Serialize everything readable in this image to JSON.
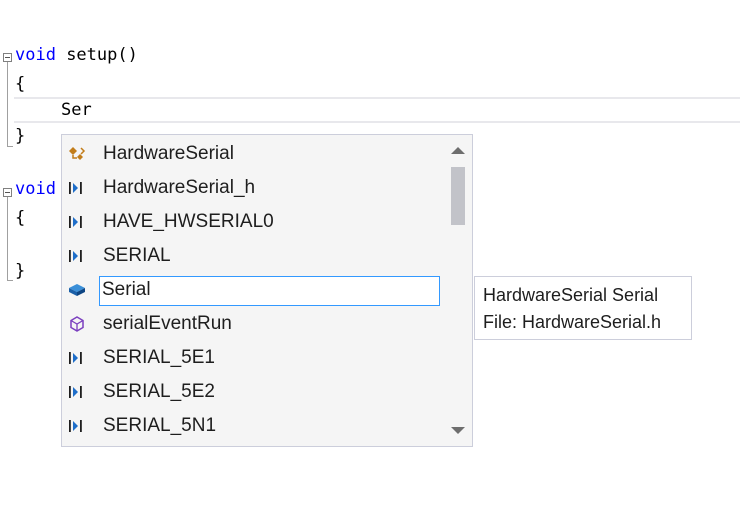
{
  "editor": {
    "line1_kw": "void",
    "line1_rest": " setup()",
    "line2": "{",
    "line3": "Ser",
    "line4": "}",
    "line5_kw": "void",
    "line6": "{",
    "line8": "}"
  },
  "completion": {
    "items": [
      {
        "label": "HardwareSerial",
        "icon": "class-icon"
      },
      {
        "label": "HardwareSerial_h",
        "icon": "macro-icon"
      },
      {
        "label": "HAVE_HWSERIAL0",
        "icon": "macro-icon"
      },
      {
        "label": "SERIAL",
        "icon": "macro-icon"
      },
      {
        "label": "Serial",
        "icon": "variable-icon",
        "selected": true
      },
      {
        "label": "serialEventRun",
        "icon": "method-icon"
      },
      {
        "label": "SERIAL_5E1",
        "icon": "macro-icon"
      },
      {
        "label": "SERIAL_5E2",
        "icon": "macro-icon"
      },
      {
        "label": "SERIAL_5N1",
        "icon": "macro-icon"
      }
    ]
  },
  "tooltip": {
    "line1": "HardwareSerial Serial",
    "line2": "File: HardwareSerial.h"
  },
  "colors": {
    "keyword": "#0000ff",
    "selection_border": "#3399ff",
    "popup_bg": "#f5f5f5"
  }
}
